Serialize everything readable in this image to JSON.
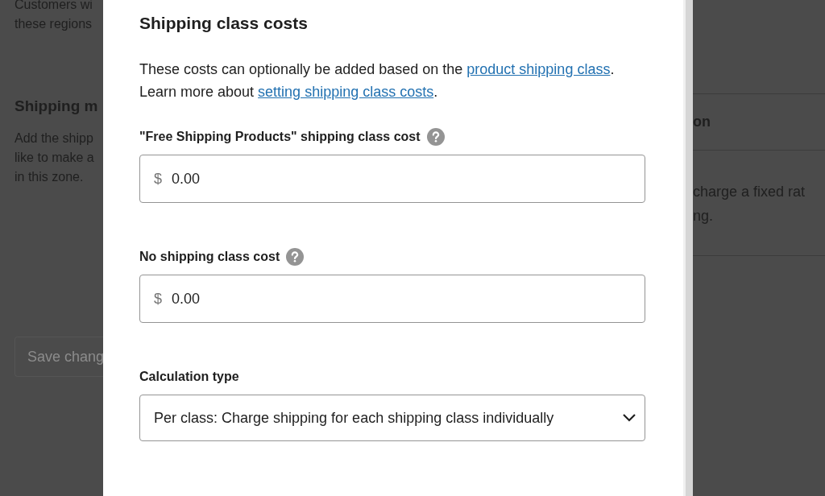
{
  "background_left": {
    "lines_top": [
      "Customers wi",
      "these regions"
    ],
    "heading": "Shipping m",
    "lines": [
      "Add the shipp",
      "like to make a",
      "in this zone."
    ],
    "button": "Save chang"
  },
  "background_right": {
    "heading": "on",
    "lines": [
      "charge a fixed rat",
      "ng."
    ]
  },
  "modal": {
    "title": "Shipping class costs",
    "description": [
      {
        "kind": "text",
        "text": "These costs can optionally be added based on the "
      },
      {
        "kind": "link",
        "text": "product shipping class"
      },
      {
        "kind": "text",
        "text": ". Learn more about "
      },
      {
        "kind": "link",
        "text": "setting shipping class costs"
      },
      {
        "kind": "text",
        "text": "."
      }
    ],
    "fields": [
      {
        "kind": "money",
        "label": "\"Free Shipping Products\" shipping class cost",
        "help": true,
        "prefix": "$",
        "value": "0.00"
      },
      {
        "kind": "money",
        "label": "No shipping class cost",
        "help": true,
        "prefix": "$",
        "value": "0.00"
      },
      {
        "kind": "select",
        "label": "Calculation type",
        "help": false,
        "value": "Per class: Charge shipping for each shipping class individually"
      }
    ]
  }
}
